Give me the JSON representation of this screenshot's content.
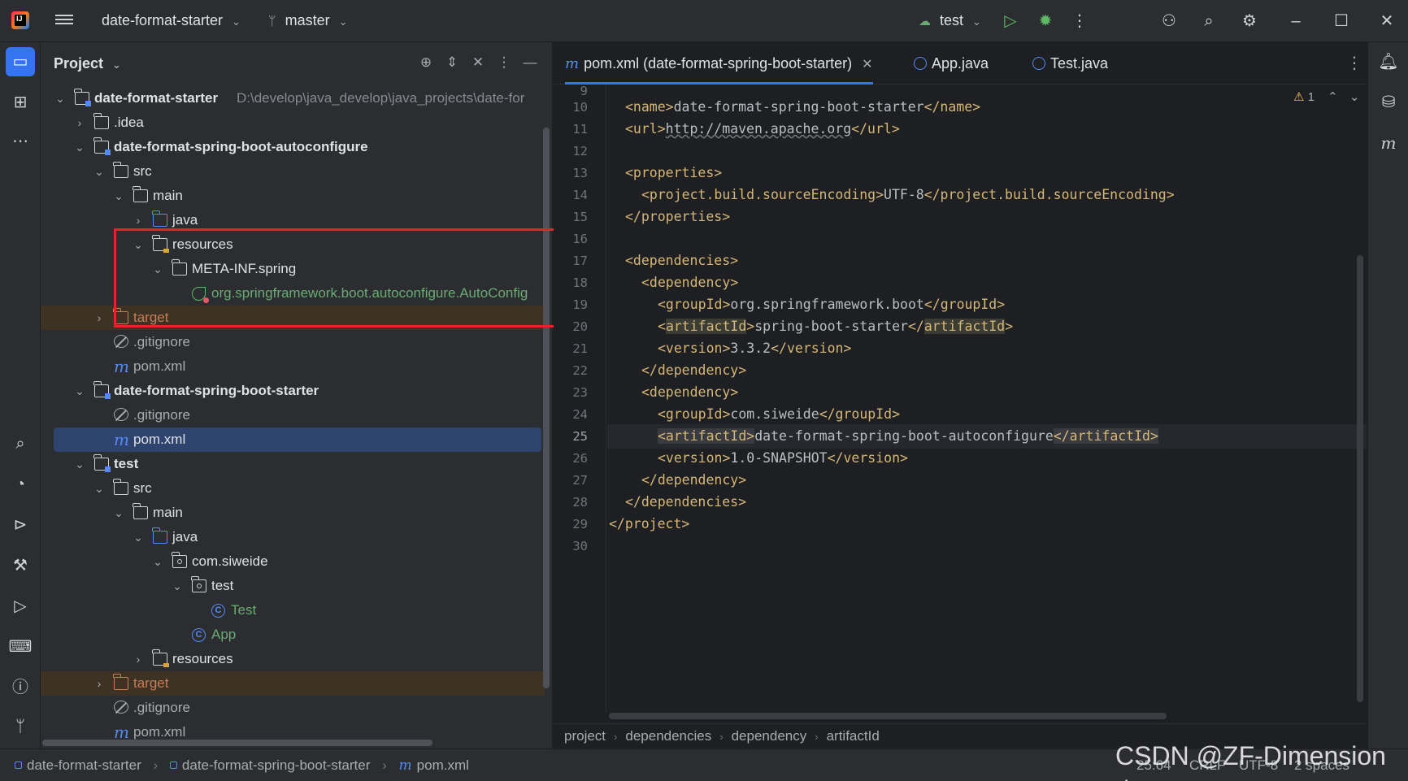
{
  "app": {
    "project_name": "date-format-starter",
    "branch": "master",
    "run_config": "test"
  },
  "project_panel": {
    "title": "Project",
    "tree": [
      {
        "label": "date-format-starter",
        "path": "D:\\develop\\java_develop\\java_projects\\date-for",
        "icon": "module-folder-icon",
        "expanded": true
      },
      {
        "label": ".idea",
        "icon": "folder-icon",
        "expanded": false
      },
      {
        "label": "date-format-spring-boot-autoconfigure",
        "icon": "module-folder-icon",
        "expanded": true
      },
      {
        "label": "src",
        "icon": "folder-icon",
        "expanded": true
      },
      {
        "label": "main",
        "icon": "folder-icon",
        "expanded": true
      },
      {
        "label": "java",
        "icon": "source-folder-icon",
        "expanded": false
      },
      {
        "label": "resources",
        "icon": "resources-folder-icon",
        "expanded": true
      },
      {
        "label": "META-INF.spring",
        "icon": "folder-icon",
        "expanded": true
      },
      {
        "label": "org.springframework.boot.autoconfigure.AutoConfig",
        "icon": "spring-leaf-icon"
      },
      {
        "label": "target",
        "icon": "excluded-folder-icon",
        "expanded": false
      },
      {
        "label": ".gitignore",
        "icon": "ignore-file-icon"
      },
      {
        "label": "pom.xml",
        "icon": "maven-file-icon"
      },
      {
        "label": "date-format-spring-boot-starter",
        "icon": "module-folder-icon",
        "expanded": true
      },
      {
        "label": ".gitignore",
        "icon": "ignore-file-icon"
      },
      {
        "label": "pom.xml",
        "icon": "maven-file-icon",
        "selected": true
      },
      {
        "label": "test",
        "icon": "module-folder-icon",
        "expanded": true
      },
      {
        "label": "src",
        "icon": "folder-icon",
        "expanded": true
      },
      {
        "label": "main",
        "icon": "folder-icon",
        "expanded": true
      },
      {
        "label": "java",
        "icon": "source-folder-icon",
        "expanded": true
      },
      {
        "label": "com.siweide",
        "icon": "package-icon",
        "expanded": true
      },
      {
        "label": "test",
        "icon": "package-icon",
        "expanded": true
      },
      {
        "label": "Test",
        "icon": "class-icon"
      },
      {
        "label": "App",
        "icon": "spring-class-icon"
      },
      {
        "label": "resources",
        "icon": "resources-folder-icon",
        "expanded": false
      },
      {
        "label": "target",
        "icon": "excluded-folder-icon",
        "expanded": false
      },
      {
        "label": ".gitignore",
        "icon": "ignore-file-icon"
      },
      {
        "label": "pom.xml",
        "icon": "maven-file-icon"
      }
    ]
  },
  "editor": {
    "tabs": [
      {
        "label": "pom.xml (date-format-spring-boot-starter)",
        "active": true
      },
      {
        "label": "App.java",
        "active": false
      },
      {
        "label": "Test.java",
        "active": false
      }
    ],
    "warning_count": "1",
    "first_line_number": "9",
    "current_line": "25",
    "lines": [
      {
        "n": "10",
        "indent": 1,
        "parts": [
          [
            "t",
            "<name>"
          ],
          [
            "x",
            "date-format-spring-boot-starter"
          ],
          [
            "t",
            "</name>"
          ]
        ]
      },
      {
        "n": "11",
        "indent": 1,
        "parts": [
          [
            "t",
            "<url>"
          ],
          [
            "u",
            "http://maven.apache.org"
          ],
          [
            "t",
            "</url>"
          ]
        ]
      },
      {
        "n": "12",
        "indent": 0,
        "parts": []
      },
      {
        "n": "13",
        "indent": 1,
        "parts": [
          [
            "t",
            "<properties>"
          ]
        ]
      },
      {
        "n": "14",
        "indent": 2,
        "parts": [
          [
            "t",
            "<project.build.sourceEncoding>"
          ],
          [
            "x",
            "UTF-8"
          ],
          [
            "t",
            "</project.build.sourceEncoding>"
          ]
        ]
      },
      {
        "n": "15",
        "indent": 1,
        "parts": [
          [
            "t",
            "</properties>"
          ]
        ]
      },
      {
        "n": "16",
        "indent": 0,
        "parts": []
      },
      {
        "n": "17",
        "indent": 1,
        "parts": [
          [
            "t",
            "<dependencies>"
          ]
        ]
      },
      {
        "n": "18",
        "indent": 2,
        "parts": [
          [
            "t",
            "<dependency>"
          ]
        ]
      },
      {
        "n": "19",
        "indent": 3,
        "parts": [
          [
            "t",
            "<groupId>"
          ],
          [
            "x",
            "org.springframework.boot"
          ],
          [
            "t",
            "</groupId>"
          ]
        ]
      },
      {
        "n": "20",
        "indent": 3,
        "parts": [
          [
            "t",
            "<"
          ],
          [
            "h",
            "artifactId"
          ],
          [
            "t",
            ">"
          ],
          [
            "x",
            "spring-boot-starter"
          ],
          [
            "t",
            "</"
          ],
          [
            "h",
            "artifactId"
          ],
          [
            "t",
            ">"
          ]
        ]
      },
      {
        "n": "21",
        "indent": 3,
        "parts": [
          [
            "t",
            "<version>"
          ],
          [
            "x",
            "3.3.2"
          ],
          [
            "t",
            "</version>"
          ]
        ]
      },
      {
        "n": "22",
        "indent": 2,
        "parts": [
          [
            "t",
            "</dependency>"
          ]
        ]
      },
      {
        "n": "23",
        "indent": 2,
        "parts": [
          [
            "t",
            "<dependency>"
          ]
        ]
      },
      {
        "n": "24",
        "indent": 3,
        "parts": [
          [
            "t",
            "<groupId>"
          ],
          [
            "x",
            "com.siweide"
          ],
          [
            "t",
            "</groupId>"
          ]
        ]
      },
      {
        "n": "25",
        "indent": 3,
        "parts": [
          [
            "H",
            "<artifactId>"
          ],
          [
            "x",
            "date-format-spring-boot-autoconfigure"
          ],
          [
            "H",
            "</artifactId>"
          ]
        ]
      },
      {
        "n": "26",
        "indent": 3,
        "parts": [
          [
            "t",
            "<version>"
          ],
          [
            "x",
            "1.0-SNAPSHOT"
          ],
          [
            "t",
            "</version>"
          ]
        ]
      },
      {
        "n": "27",
        "indent": 2,
        "parts": [
          [
            "t",
            "</dependency>"
          ]
        ]
      },
      {
        "n": "28",
        "indent": 1,
        "parts": [
          [
            "t",
            "</dependencies>"
          ]
        ]
      },
      {
        "n": "29",
        "indent": 0,
        "parts": [
          [
            "t",
            "</project>"
          ]
        ]
      },
      {
        "n": "30",
        "indent": 0,
        "parts": []
      }
    ],
    "breadcrumbs": [
      "project",
      "dependencies",
      "dependency",
      "artifactId"
    ]
  },
  "statusbar": {
    "crumbs": [
      "date-format-starter",
      "date-format-spring-boot-starter",
      "pom.xml"
    ],
    "position": "25:64",
    "line_sep": "CRLF",
    "encoding": "UTF-8",
    "indent": "2 spaces"
  },
  "watermark": "CSDN @ZF-Dimensionあ",
  "colors": {
    "accent": "#3574f0",
    "xml_tag": "#d5b778",
    "selection_box": "#e3242b",
    "spring_green": "#6aab73",
    "excluded_orange": "#c77d55"
  }
}
